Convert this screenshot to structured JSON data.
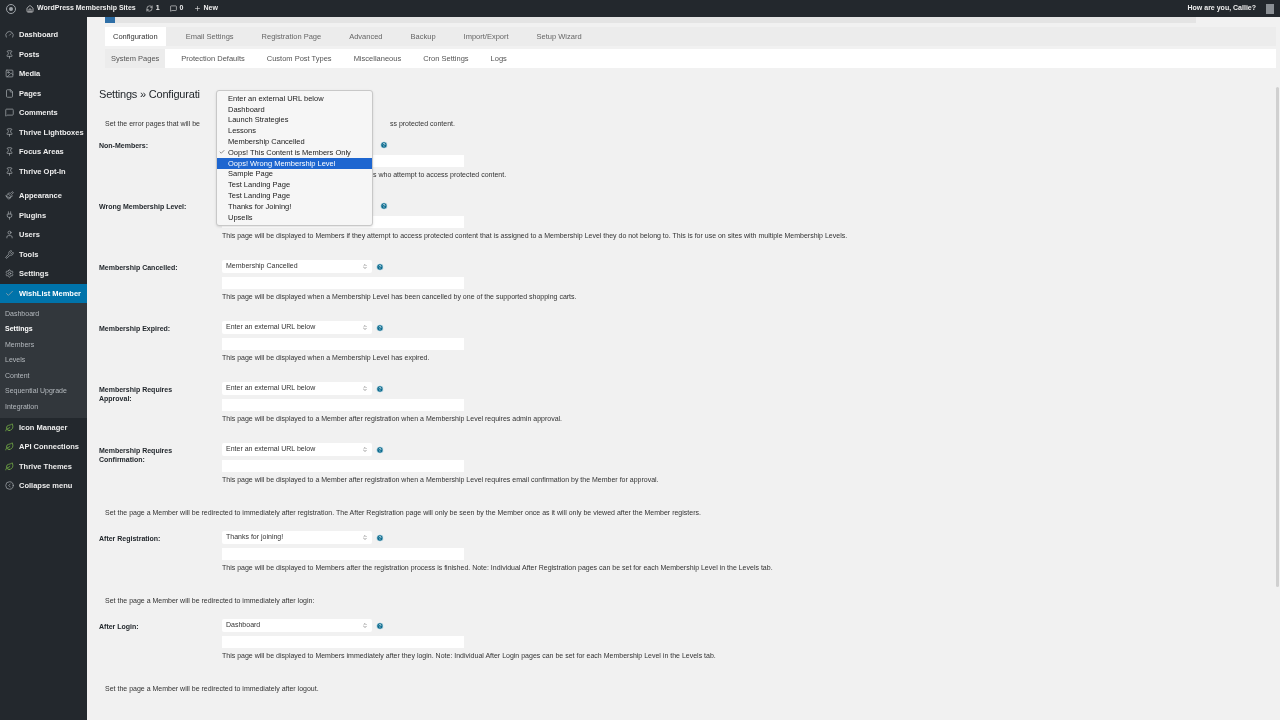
{
  "admin_bar": {
    "site": "WordPress Membership Sites",
    "updates": "1",
    "comments": "0",
    "new": "New",
    "greeting": "How are you, Callie?"
  },
  "sidebar": {
    "items": [
      {
        "label": "Dashboard",
        "selected": false
      },
      {
        "label": "Posts",
        "selected": false
      },
      {
        "label": "Media",
        "selected": false
      },
      {
        "label": "Pages",
        "selected": false
      },
      {
        "label": "Comments",
        "selected": false
      },
      {
        "label": "Thrive Lightboxes",
        "selected": false
      },
      {
        "label": "Focus Areas",
        "selected": false
      },
      {
        "label": "Thrive Opt-In",
        "selected": false
      },
      {
        "label": "Appearance",
        "selected": false
      },
      {
        "label": "Plugins",
        "selected": false
      },
      {
        "label": "Users",
        "selected": false
      },
      {
        "label": "Tools",
        "selected": false
      },
      {
        "label": "Settings",
        "selected": false
      },
      {
        "label": "WishList Member",
        "selected": true,
        "children": [
          {
            "label": "Dashboard",
            "selected": false
          },
          {
            "label": "Settings",
            "selected": true
          },
          {
            "label": "Members",
            "selected": false
          },
          {
            "label": "Levels",
            "selected": false
          },
          {
            "label": "Content",
            "selected": false
          },
          {
            "label": "Sequential Upgrade",
            "selected": false
          },
          {
            "label": "Integration",
            "selected": false
          }
        ]
      },
      {
        "label": "Icon Manager",
        "selected": false
      },
      {
        "label": "API Connections",
        "selected": false
      },
      {
        "label": "Thrive Themes",
        "selected": false
      },
      {
        "label": "Collapse menu",
        "selected": false
      }
    ]
  },
  "tabs": [
    {
      "label": "Configuration",
      "selected": true
    },
    {
      "label": "Email Settings",
      "selected": false
    },
    {
      "label": "Registration Page",
      "selected": false
    },
    {
      "label": "Advanced",
      "selected": false
    },
    {
      "label": "Backup",
      "selected": false
    },
    {
      "label": "Import/Export",
      "selected": false
    },
    {
      "label": "Setup Wizard",
      "selected": false
    }
  ],
  "subtabs": [
    {
      "label": "System Pages",
      "selected": true
    },
    {
      "label": "Protection Defaults",
      "selected": false
    },
    {
      "label": "Custom Post Types",
      "selected": false
    },
    {
      "label": "Miscellaneous",
      "selected": false
    },
    {
      "label": "Cron Settings",
      "selected": false
    },
    {
      "label": "Logs",
      "selected": false
    }
  ],
  "heading": "Settings » Configurati",
  "items": [
    {
      "kind": "split_note",
      "before": "Set the error pages that will be",
      "after": "ss protected content."
    },
    {
      "kind": "hidden_field",
      "label": "Non-Members:",
      "description": "s who attempt to access protected content."
    },
    {
      "kind": "covered_field",
      "label": "Wrong Membership Level:",
      "description": "This page will be displayed to Members if they attempt to access protected content that is assigned to a Membership Level they do not belong to. This is for use on sites with multiple Membership Levels."
    },
    {
      "kind": "field",
      "label": "Membership Cancelled:",
      "value": "Membership Cancelled",
      "description": "This page will be displayed when a Membership Level has been cancelled by one of the supported shopping carts."
    },
    {
      "kind": "field",
      "label": "Membership Expired:",
      "value": "Enter an external URL below",
      "description": "This page will be displayed when a Membership Level has expired."
    },
    {
      "kind": "field",
      "label": "Membership Requires Approval:",
      "value": "Enter an external URL below",
      "description": "This page will be displayed to a Member after registration when a Membership Level requires admin approval."
    },
    {
      "kind": "field",
      "label": "Membership Requires Confirmation:",
      "value": "Enter an external URL below",
      "description": "This page will be displayed to a Member after registration when a Membership Level requires email confirmation by the Member for approval."
    },
    {
      "kind": "note",
      "text": "Set the page a Member will be redirected to immediately after registration. The After Registration page will only be seen by the Member once as it will only be viewed after the Member registers."
    },
    {
      "kind": "field",
      "label": "After Registration:",
      "value": "Thanks for joining!",
      "description": "This page will be displayed to Members after the registration process is finished. Note: Individual After Registration pages can be set for each Membership Level in the Levels tab."
    },
    {
      "kind": "note",
      "text": "Set the page a Member will be redirected to immediately after login:"
    },
    {
      "kind": "field",
      "label": "After Login:",
      "value": "Dashboard",
      "description": "This page will be displayed to Members immediately after they login. Note: Individual After Login pages can be set for each Membership Level in the Levels tab."
    },
    {
      "kind": "note",
      "text": "Set the page a Member will be redirected to immediately after logout."
    }
  ],
  "menu": [
    {
      "label": "Enter an external URL below",
      "checked": false,
      "selected": false
    },
    {
      "label": "Dashboard",
      "checked": false,
      "selected": false
    },
    {
      "label": "Launch Strategies",
      "checked": false,
      "selected": false
    },
    {
      "label": "Lessons",
      "checked": false,
      "selected": false
    },
    {
      "label": "Membership Cancelled",
      "checked": false,
      "selected": false
    },
    {
      "label": "Oops! This Content is Members Only",
      "checked": true,
      "selected": false
    },
    {
      "label": "Oops! Wrong Membership Level",
      "checked": false,
      "selected": true
    },
    {
      "label": "Sample Page",
      "checked": false,
      "selected": false
    },
    {
      "label": "Test Landing Page",
      "checked": false,
      "selected": false
    },
    {
      "label": "Test Landing Page",
      "checked": false,
      "selected": false
    },
    {
      "label": "Thanks for Joining!",
      "checked": false,
      "selected": false
    },
    {
      "label": "Upsells",
      "checked": false,
      "selected": false
    }
  ]
}
